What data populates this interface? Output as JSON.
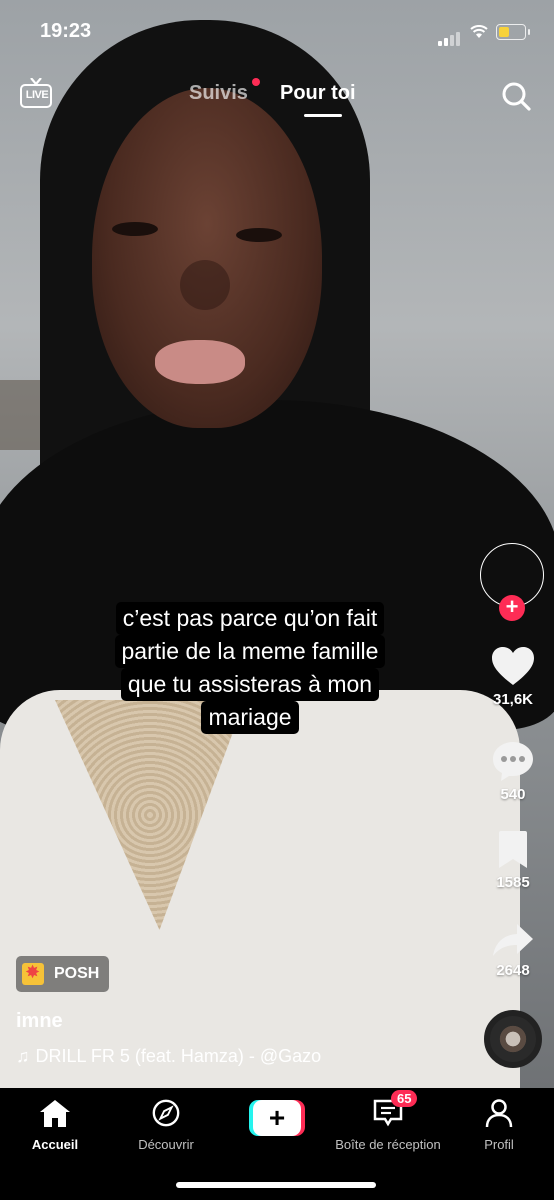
{
  "status_bar": {
    "time": "19:23",
    "battery_level": 0.35,
    "battery_color": "#f7d23b"
  },
  "top_nav": {
    "live_label": "LIVE",
    "following_tab": "Suivis",
    "for_you_tab": "Pour toi"
  },
  "video": {
    "caption_lines": [
      "c’est pas parce qu’on fait",
      "partie de la meme famille",
      "que tu assisteras à mon",
      "mariage"
    ],
    "badge_label": "POSH",
    "author": "imne",
    "sound": "DRILL FR 5 (feat. Hamza) - @Gazo"
  },
  "actions": {
    "likes": "31,6K",
    "comments": "540",
    "saves": "1585",
    "shares": "2648"
  },
  "tab_bar": {
    "home": "Accueil",
    "discover": "Découvrir",
    "inbox": "Boîte de réception",
    "inbox_count": "65",
    "profile": "Profil"
  },
  "colors": {
    "accent": "#fe2c55",
    "cyan": "#25f4ee"
  }
}
